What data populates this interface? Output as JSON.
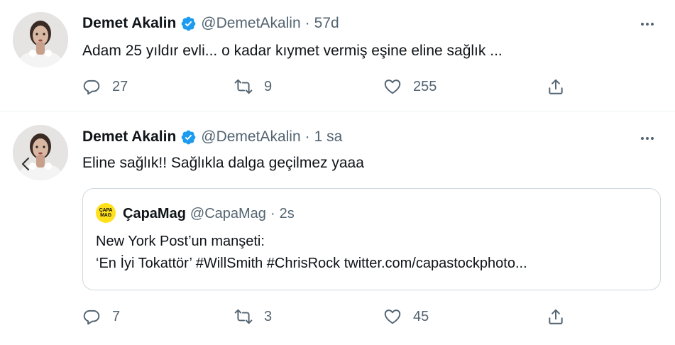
{
  "tweets": [
    {
      "author_name": "Demet Akalin",
      "handle": "@DemetAkalin",
      "separator": "·",
      "time": "57d",
      "text": "Adam 25 yıldır evli... o kadar kıymet vermiş eşine eline sağlık ...",
      "replies": "27",
      "retweets": "9",
      "likes": "255"
    },
    {
      "author_name": "Demet Akalin",
      "handle": "@DemetAkalin",
      "separator": "·",
      "time": "1 sa",
      "text": "Eline sağlık!! Sağlıkla dalga geçilmez yaaa",
      "quote": {
        "avatar_text": "ÇAPA MAG",
        "author_name": "ÇapaMag",
        "handle": "@CapaMag",
        "separator": "·",
        "time": "2s",
        "line1": "New York Post’un manşeti:",
        "line2": "‘En İyi Tokattör’ #WillSmith #ChrisRock twitter.com/capastockphoto..."
      },
      "replies": "7",
      "retweets": "3",
      "likes": "45"
    }
  ],
  "icons": {
    "reply": "reply-icon",
    "retweet": "retweet-icon",
    "like": "heart-icon",
    "share": "share-icon",
    "more": "more-icon",
    "verified": "verified-badge-icon"
  },
  "colors": {
    "verified_blue": "#1d9bf0",
    "secondary_text": "#536471",
    "border": "#cfd9de",
    "quote_avatar_yellow": "#ffe01b"
  }
}
